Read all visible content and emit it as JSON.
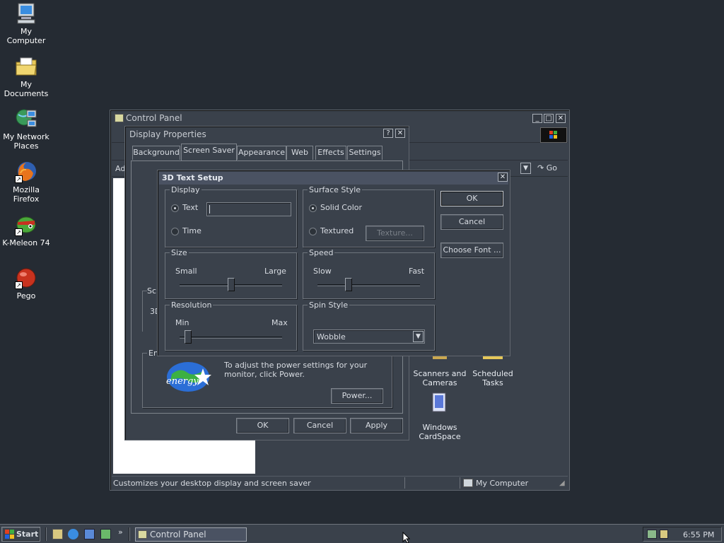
{
  "desktop": {
    "icons": [
      {
        "label": "My Computer",
        "icon": "computer-icon"
      },
      {
        "label": "My Documents",
        "icon": "folder-icon"
      },
      {
        "label": "My Network Places",
        "icon": "network-icon"
      },
      {
        "label": "Mozilla Firefox",
        "icon": "firefox-icon"
      },
      {
        "label": "K-Meleon 74",
        "icon": "kmeleon-icon"
      },
      {
        "label": "Pego",
        "icon": "pego-icon"
      }
    ]
  },
  "control_panel": {
    "title": "Control Panel",
    "address_label": "Ad",
    "go_label": "Go",
    "status_text": "Customizes your desktop display and screen saver",
    "status_zone": "My Computer",
    "items": [
      {
        "label": "Scanners and Cameras"
      },
      {
        "label": "Scheduled Tasks"
      },
      {
        "label": "Windows CardSpace"
      }
    ]
  },
  "display_properties": {
    "title": "Display Properties",
    "tabs": [
      "Background",
      "Screen Saver",
      "Appearance",
      "Web",
      "Effects",
      "Settings"
    ],
    "screensaver_group": "Sc",
    "screensaver_value": "3D",
    "energy_group": "En",
    "energy_text": "To adjust the power settings for your monitor, click Power.",
    "energy_logo": "energy",
    "power_button": "Power...",
    "ok": "OK",
    "cancel": "Cancel",
    "apply": "Apply"
  },
  "text_setup": {
    "title": "3D Text Setup",
    "display_group": "Display",
    "text_option": "Text",
    "time_option": "Time",
    "text_value": "",
    "surface_group": "Surface Style",
    "solid_option": "Solid Color",
    "textured_option": "Textured",
    "texture_button": "Texture...",
    "size_group": "Size",
    "size_min": "Small",
    "size_max": "Large",
    "size_level": 0.5,
    "speed_group": "Speed",
    "speed_min": "Slow",
    "speed_max": "Fast",
    "speed_level": 0.3,
    "resolution_group": "Resolution",
    "res_min": "Min",
    "res_max": "Max",
    "res_level": 0.08,
    "spin_group": "Spin Style",
    "spin_value": "Wobble",
    "ok": "OK",
    "cancel": "Cancel",
    "choose_font": "Choose Font ..."
  },
  "taskbar": {
    "start": "Start",
    "task": "Control Panel",
    "clock": "6:55 PM"
  }
}
